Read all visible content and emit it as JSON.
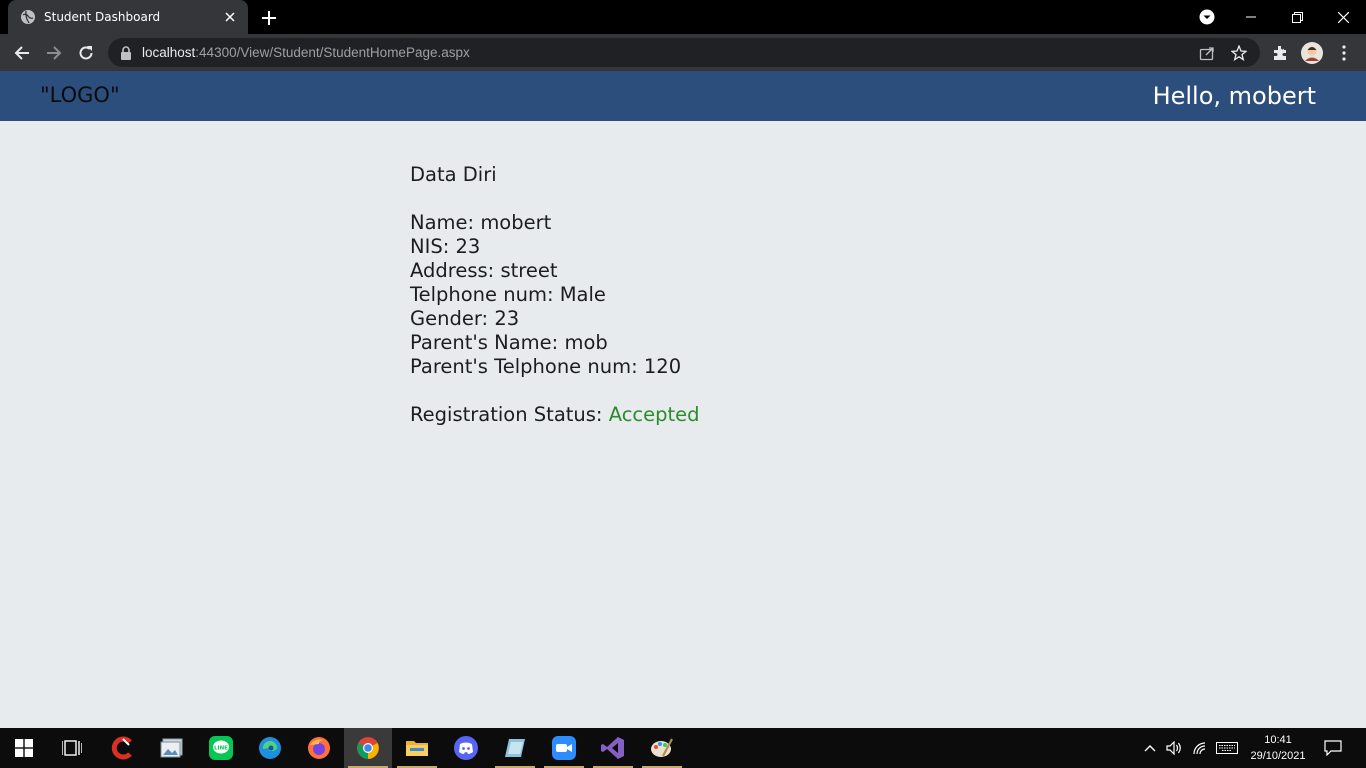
{
  "browser": {
    "tab_title": "Student Dashboard",
    "url_host": "localhost",
    "url_path": ":44300/View/Student/StudentHomePage.aspx"
  },
  "header": {
    "logo": "\"LOGO\"",
    "greeting": "Hello, mobert"
  },
  "profile": {
    "title": "Data Diri",
    "fields": [
      {
        "label": "Name",
        "value": "mobert"
      },
      {
        "label": "NIS",
        "value": "23"
      },
      {
        "label": "Address",
        "value": "street"
      },
      {
        "label": "Telphone num",
        "value": "Male"
      },
      {
        "label": "Gender",
        "value": "23"
      },
      {
        "label": "Parent's Name",
        "value": "mob"
      },
      {
        "label": "Parent's Telphone num",
        "value": "120"
      }
    ],
    "status_label": "Registration Status:",
    "status_value": "Accepted"
  },
  "taskbar": {
    "apps": [
      "ccleaner-icon",
      "photos-icon",
      "line-icon",
      "edge-icon",
      "firefox-icon",
      "chrome-icon",
      "file-explorer-icon",
      "discord-icon",
      "notepad-icon",
      "zoom-icon",
      "visual-studio-icon",
      "paint-icon"
    ],
    "time": "10:41",
    "date": "29/10/2021"
  },
  "colors": {
    "header_bg": "#2b4e7c",
    "page_bg": "#e7ebee",
    "status_accepted": "#2d8b2d"
  }
}
